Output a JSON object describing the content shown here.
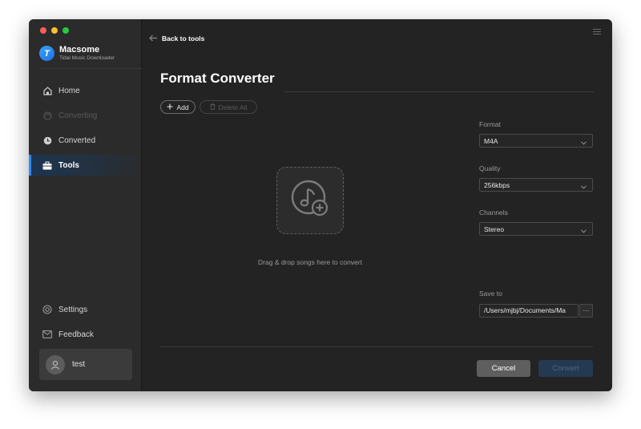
{
  "app": {
    "name": "Macsome",
    "subtitle": "Tidal Music Downloader",
    "logo_letter": "T",
    "accent_color": "#2f8bff"
  },
  "sidebar": {
    "items": [
      {
        "label": "Home",
        "icon": "home-icon",
        "state": "normal"
      },
      {
        "label": "Converting",
        "icon": "sync-icon",
        "state": "disabled"
      },
      {
        "label": "Converted",
        "icon": "clock-icon",
        "state": "normal"
      },
      {
        "label": "Tools",
        "icon": "toolbox-icon",
        "state": "active"
      }
    ],
    "settings_label": "Settings",
    "feedback_label": "Feedback",
    "user": {
      "name": "test",
      "icon": "user-icon"
    }
  },
  "header": {
    "back_label": "Back to tools",
    "menu_icon": "hamburger-menu-icon"
  },
  "main": {
    "title": "Format Converter",
    "add_label": "Add",
    "delete_all_label": "Delete All",
    "drop_text": "Drag & drop songs here to convert",
    "drop_icon": "music-note-add-icon"
  },
  "settings": {
    "format": {
      "label": "Format",
      "value": "M4A"
    },
    "quality": {
      "label": "Quality",
      "value": "256kbps"
    },
    "channels": {
      "label": "Channels",
      "value": "Stereo"
    },
    "save_to": {
      "label": "Save to",
      "value": "/Users/mjbj/Documents/Ma",
      "browse_label": "···"
    }
  },
  "actions": {
    "cancel_label": "Cancel",
    "convert_label": "Convert"
  }
}
